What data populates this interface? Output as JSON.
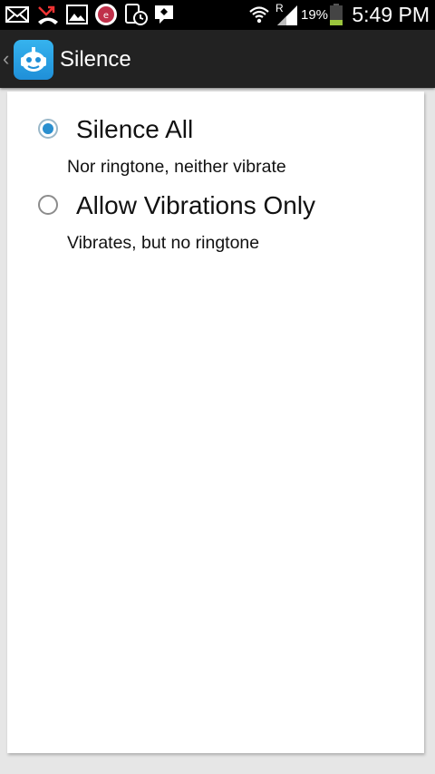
{
  "status_bar": {
    "icons": [
      "mail-icon",
      "missed-call-icon",
      "image-icon",
      "notification-app-icon",
      "device-clock-icon",
      "chat-bubble-icon",
      "wifi-icon",
      "signal-roaming-icon",
      "battery-icon"
    ],
    "roaming_indicator": "R",
    "battery_percent": "19%",
    "time": "5:49 PM"
  },
  "action_bar": {
    "title": "Silence",
    "app_icon": "robot-face-icon"
  },
  "options": [
    {
      "label": "Silence All",
      "description": "Nor ringtone, neither vibrate",
      "selected": true
    },
    {
      "label": "Allow Vibrations Only",
      "description": "Vibrates, but no ringtone",
      "selected": false
    }
  ],
  "colors": {
    "accent": "#2a8fcf",
    "action_bar": "#222222",
    "status_bar": "#000000",
    "battery_low": "#9bc53d"
  }
}
